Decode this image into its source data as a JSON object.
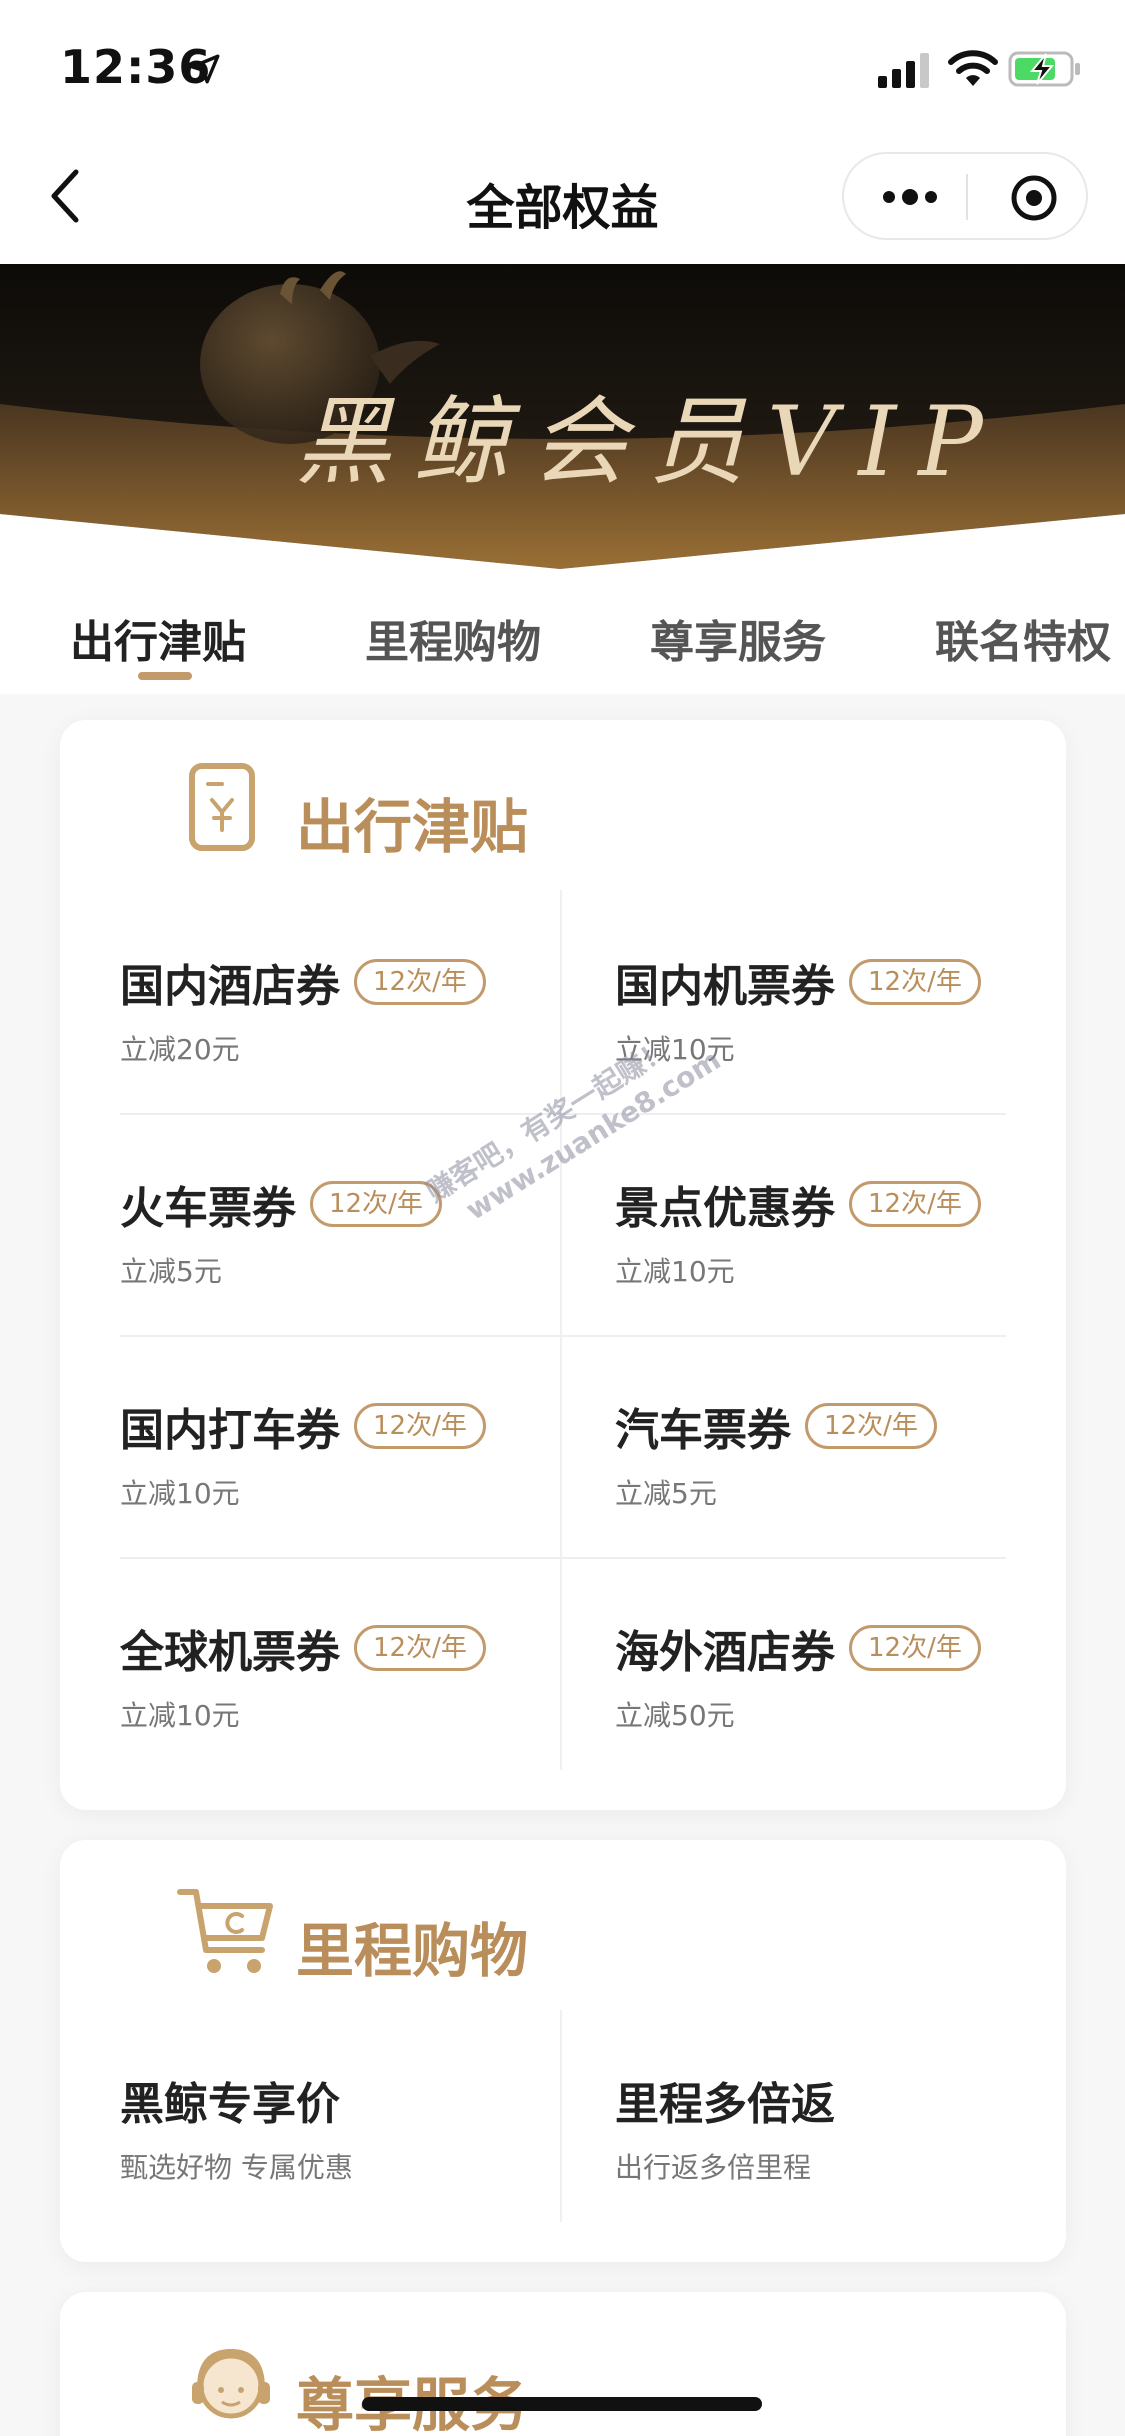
{
  "status_bar": {
    "time": "12:36"
  },
  "nav": {
    "title": "全部权益"
  },
  "banner": {
    "title": "黑鲸会员VIP"
  },
  "tabs": [
    {
      "label": "出行津贴",
      "active": true
    },
    {
      "label": "里程购物",
      "active": false
    },
    {
      "label": "尊享服务",
      "active": false
    },
    {
      "label": "联名特权",
      "active": false
    }
  ],
  "sections": {
    "travel": {
      "title": "出行津贴",
      "icon": "voucher-icon",
      "items": [
        {
          "name": "国内酒店券",
          "badge": "12次/年",
          "desc": "立减20元"
        },
        {
          "name": "国内机票券",
          "badge": "12次/年",
          "desc": "立减10元"
        },
        {
          "name": "火车票券",
          "badge": "12次/年",
          "desc": "立减5元"
        },
        {
          "name": "景点优惠券",
          "badge": "12次/年",
          "desc": "立减10元"
        },
        {
          "name": "国内打车券",
          "badge": "12次/年",
          "desc": "立减10元"
        },
        {
          "name": "汽车票券",
          "badge": "12次/年",
          "desc": "立减5元"
        },
        {
          "name": "全球机票券",
          "badge": "12次/年",
          "desc": "立减10元"
        },
        {
          "name": "海外酒店券",
          "badge": "12次/年",
          "desc": "立减50元"
        }
      ]
    },
    "shopping": {
      "title": "里程购物",
      "icon": "cart-icon",
      "items": [
        {
          "name": "黑鲸专享价",
          "desc": "甄选好物 专属优惠"
        },
        {
          "name": "里程多倍返",
          "desc": "出行返多倍里程"
        }
      ]
    },
    "service": {
      "title": "尊享服务",
      "icon": "customer-service-icon"
    }
  },
  "watermark": {
    "line1": "赚客吧，有奖一起赚！",
    "line2": "www.zuanke8.com"
  },
  "colors": {
    "accent": "#b98e5a",
    "badge_border": "#c29a6b",
    "banner_dark": "#1a1611",
    "banner_gold": "#8a6330"
  }
}
